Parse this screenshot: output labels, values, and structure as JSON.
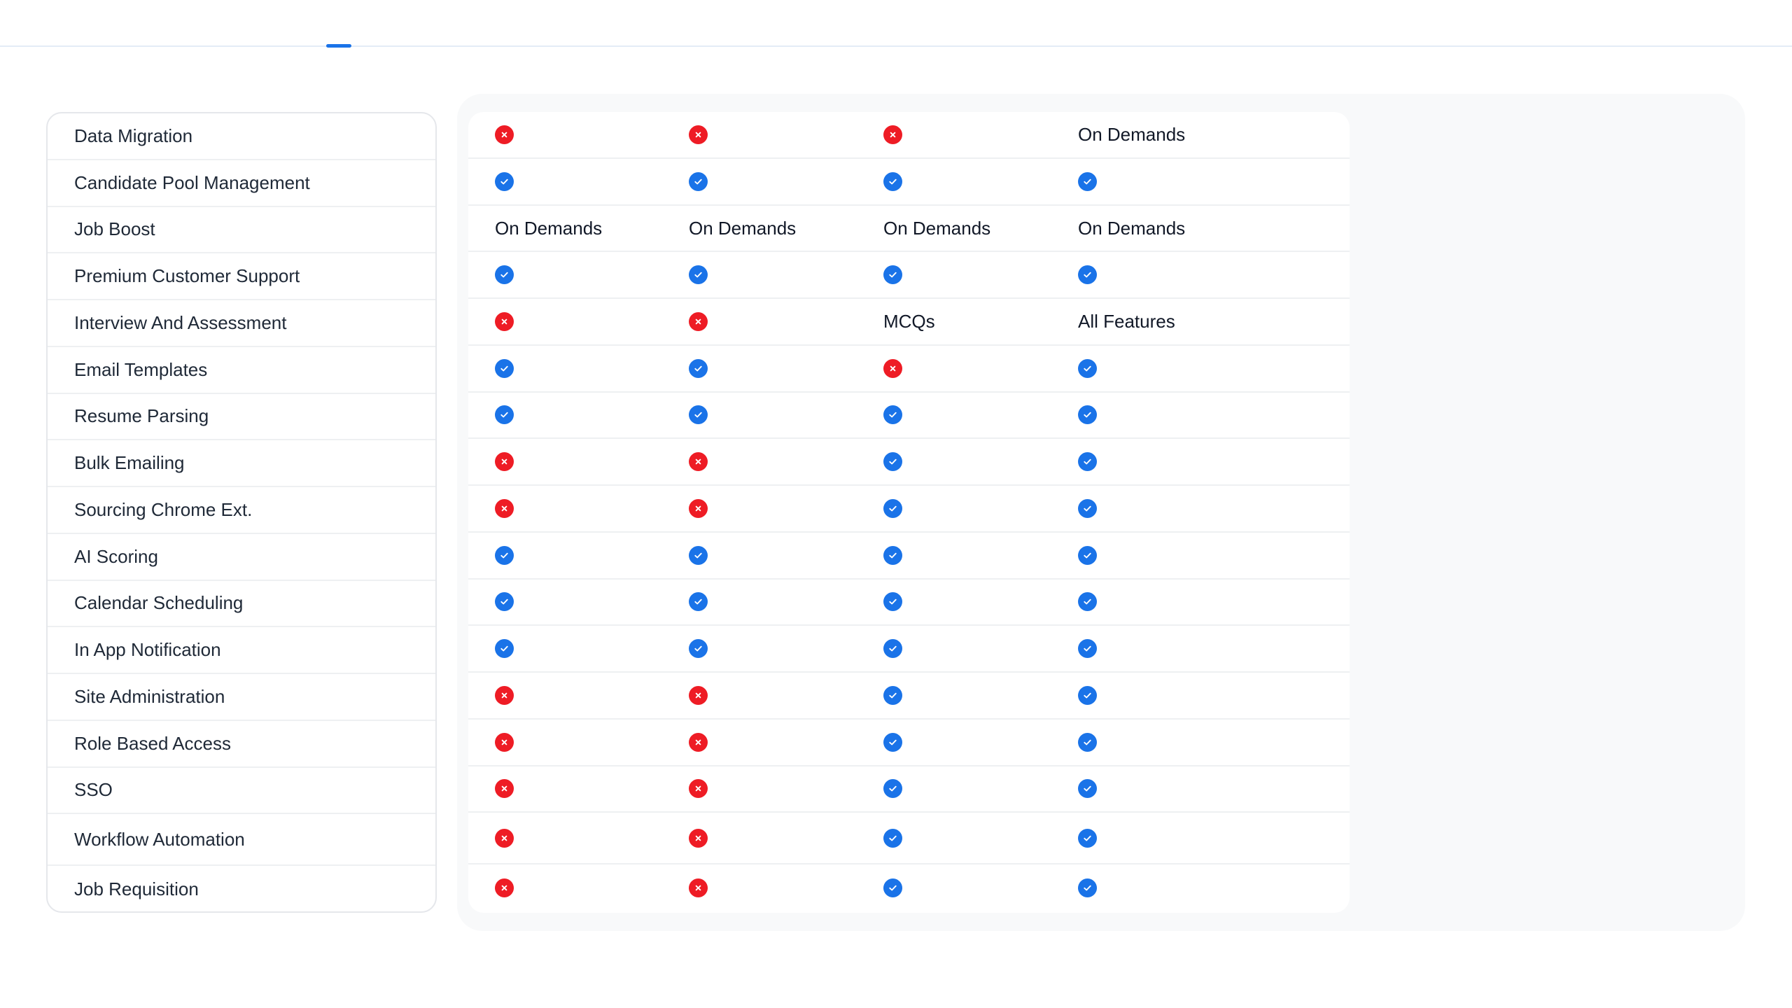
{
  "colors": {
    "accent": "#1a73e8",
    "check": "#1a73e8",
    "cross": "#ee1c25",
    "panel_background": "#f8f9fa"
  },
  "features": [
    "Data Migration",
    "Candidate Pool Management",
    "Job Boost",
    "Premium Customer Support",
    "Interview And Assessment",
    "Email Templates",
    "Resume Parsing",
    "Bulk Emailing",
    "Sourcing Chrome Ext.",
    "AI Scoring",
    "Calendar Scheduling",
    "In App Notification",
    "Site Administration",
    "Role Based Access",
    "SSO",
    "Workflow Automation",
    "Job Requisition"
  ],
  "plans": [
    {
      "cells": [
        {
          "type": "icon",
          "icon": "cross-icon"
        },
        {
          "type": "icon",
          "icon": "check-icon"
        },
        {
          "type": "text",
          "text": "On Demands"
        },
        {
          "type": "icon",
          "icon": "check-icon"
        },
        {
          "type": "icon",
          "icon": "cross-icon"
        },
        {
          "type": "icon",
          "icon": "check-icon"
        },
        {
          "type": "icon",
          "icon": "check-icon"
        },
        {
          "type": "icon",
          "icon": "cross-icon"
        },
        {
          "type": "icon",
          "icon": "cross-icon"
        },
        {
          "type": "icon",
          "icon": "check-icon"
        },
        {
          "type": "icon",
          "icon": "check-icon"
        },
        {
          "type": "icon",
          "icon": "check-icon"
        },
        {
          "type": "icon",
          "icon": "cross-icon"
        },
        {
          "type": "icon",
          "icon": "cross-icon"
        },
        {
          "type": "icon",
          "icon": "cross-icon"
        },
        {
          "type": "icon",
          "icon": "cross-icon"
        },
        {
          "type": "icon",
          "icon": "cross-icon"
        }
      ]
    },
    {
      "cells": [
        {
          "type": "icon",
          "icon": "cross-icon"
        },
        {
          "type": "icon",
          "icon": "check-icon"
        },
        {
          "type": "text",
          "text": "On Demands"
        },
        {
          "type": "icon",
          "icon": "check-icon"
        },
        {
          "type": "icon",
          "icon": "cross-icon"
        },
        {
          "type": "icon",
          "icon": "check-icon"
        },
        {
          "type": "icon",
          "icon": "check-icon"
        },
        {
          "type": "icon",
          "icon": "cross-icon"
        },
        {
          "type": "icon",
          "icon": "cross-icon"
        },
        {
          "type": "icon",
          "icon": "check-icon"
        },
        {
          "type": "icon",
          "icon": "check-icon"
        },
        {
          "type": "icon",
          "icon": "check-icon"
        },
        {
          "type": "icon",
          "icon": "cross-icon"
        },
        {
          "type": "icon",
          "icon": "cross-icon"
        },
        {
          "type": "icon",
          "icon": "cross-icon"
        },
        {
          "type": "icon",
          "icon": "cross-icon"
        },
        {
          "type": "icon",
          "icon": "cross-icon"
        }
      ]
    },
    {
      "cells": [
        {
          "type": "icon",
          "icon": "cross-icon"
        },
        {
          "type": "icon",
          "icon": "check-icon"
        },
        {
          "type": "text",
          "text": "On Demands"
        },
        {
          "type": "icon",
          "icon": "check-icon"
        },
        {
          "type": "text",
          "text": "MCQs"
        },
        {
          "type": "icon",
          "icon": "cross-icon"
        },
        {
          "type": "icon",
          "icon": "check-icon"
        },
        {
          "type": "icon",
          "icon": "check-icon"
        },
        {
          "type": "icon",
          "icon": "check-icon"
        },
        {
          "type": "icon",
          "icon": "check-icon"
        },
        {
          "type": "icon",
          "icon": "check-icon"
        },
        {
          "type": "icon",
          "icon": "check-icon"
        },
        {
          "type": "icon",
          "icon": "check-icon"
        },
        {
          "type": "icon",
          "icon": "check-icon"
        },
        {
          "type": "icon",
          "icon": "check-icon"
        },
        {
          "type": "icon",
          "icon": "check-icon"
        },
        {
          "type": "icon",
          "icon": "check-icon"
        }
      ]
    },
    {
      "cells": [
        {
          "type": "text",
          "text": "On Demands"
        },
        {
          "type": "icon",
          "icon": "check-icon"
        },
        {
          "type": "text",
          "text": "On Demands"
        },
        {
          "type": "icon",
          "icon": "check-icon"
        },
        {
          "type": "text",
          "text": "All Features"
        },
        {
          "type": "icon",
          "icon": "check-icon"
        },
        {
          "type": "icon",
          "icon": "check-icon"
        },
        {
          "type": "icon",
          "icon": "check-icon"
        },
        {
          "type": "icon",
          "icon": "check-icon"
        },
        {
          "type": "icon",
          "icon": "check-icon"
        },
        {
          "type": "icon",
          "icon": "check-icon"
        },
        {
          "type": "icon",
          "icon": "check-icon"
        },
        {
          "type": "icon",
          "icon": "check-icon"
        },
        {
          "type": "icon",
          "icon": "check-icon"
        },
        {
          "type": "icon",
          "icon": "check-icon"
        },
        {
          "type": "icon",
          "icon": "check-icon"
        },
        {
          "type": "icon",
          "icon": "check-icon"
        }
      ]
    }
  ]
}
